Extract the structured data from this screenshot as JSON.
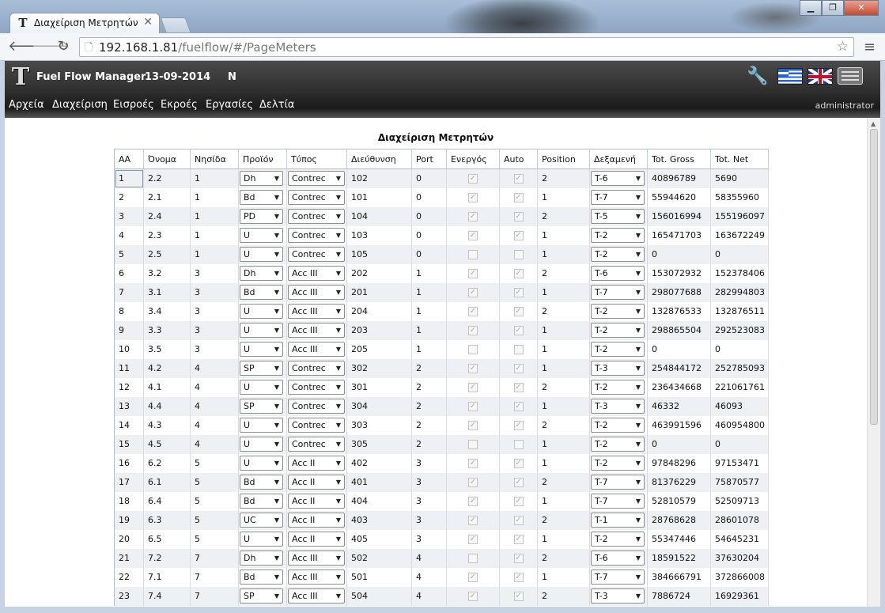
{
  "browser": {
    "tab_title": "Διαχείριση Μετρητών",
    "url_host": "192.168.1.81",
    "url_path": "/fuelflow/#/PageMeters"
  },
  "app": {
    "title": "Fuel Flow Manager",
    "date": "13-09-2014",
    "mode": "N",
    "user": "administrator",
    "menu": [
      "Αρχεία",
      "Διαχείριση",
      "Εισροές",
      "Εκροές",
      "Εργασίες",
      "Δελτία"
    ]
  },
  "page": {
    "caption": "Διαχείριση Μετρητών",
    "columns": [
      "ΑΑ",
      "Όνομα",
      "Νησίδα",
      "Προϊόν",
      "Τύπος",
      "Διεύθυνση",
      "Port",
      "Ενεργός",
      "Auto",
      "Position",
      "Δεξαμενή",
      "Tot. Gross",
      "Tot. Net"
    ],
    "rows": [
      {
        "aa": "1",
        "name": "2.2",
        "island": "1",
        "product": "Dh",
        "type": "Contrec",
        "address": "102",
        "port": "0",
        "active": true,
        "auto": true,
        "position": "2",
        "tank": "T-6",
        "gross": "40896789",
        "net": "5690"
      },
      {
        "aa": "2",
        "name": "2.1",
        "island": "1",
        "product": "Bd",
        "type": "Contrec",
        "address": "101",
        "port": "0",
        "active": true,
        "auto": true,
        "position": "1",
        "tank": "T-7",
        "gross": "55944620",
        "net": "58355960"
      },
      {
        "aa": "3",
        "name": "2.4",
        "island": "1",
        "product": "PD",
        "type": "Contrec",
        "address": "104",
        "port": "0",
        "active": true,
        "auto": true,
        "position": "2",
        "tank": "T-5",
        "gross": "156016994",
        "net": "155196097"
      },
      {
        "aa": "4",
        "name": "2.3",
        "island": "1",
        "product": "U",
        "type": "Contrec",
        "address": "103",
        "port": "0",
        "active": true,
        "auto": true,
        "position": "1",
        "tank": "T-2",
        "gross": "165471703",
        "net": "163672249"
      },
      {
        "aa": "5",
        "name": "2.5",
        "island": "1",
        "product": "U",
        "type": "Contrec",
        "address": "105",
        "port": "0",
        "active": false,
        "auto": false,
        "position": "1",
        "tank": "T-2",
        "gross": "0",
        "net": "0"
      },
      {
        "aa": "6",
        "name": "3.2",
        "island": "3",
        "product": "Dh",
        "type": "Acc III",
        "address": "202",
        "port": "1",
        "active": true,
        "auto": true,
        "position": "2",
        "tank": "T-6",
        "gross": "153072932",
        "net": "152378406"
      },
      {
        "aa": "7",
        "name": "3.1",
        "island": "3",
        "product": "Bd",
        "type": "Acc III",
        "address": "201",
        "port": "1",
        "active": true,
        "auto": true,
        "position": "1",
        "tank": "T-7",
        "gross": "298077688",
        "net": "282994803"
      },
      {
        "aa": "8",
        "name": "3.4",
        "island": "3",
        "product": "U",
        "type": "Acc III",
        "address": "204",
        "port": "1",
        "active": true,
        "auto": true,
        "position": "2",
        "tank": "T-2",
        "gross": "132876533",
        "net": "132876511"
      },
      {
        "aa": "9",
        "name": "3.3",
        "island": "3",
        "product": "U",
        "type": "Acc III",
        "address": "203",
        "port": "1",
        "active": true,
        "auto": true,
        "position": "1",
        "tank": "T-2",
        "gross": "298865504",
        "net": "292523083"
      },
      {
        "aa": "10",
        "name": "3.5",
        "island": "3",
        "product": "U",
        "type": "Acc III",
        "address": "205",
        "port": "1",
        "active": false,
        "auto": false,
        "position": "1",
        "tank": "T-2",
        "gross": "0",
        "net": "0"
      },
      {
        "aa": "11",
        "name": "4.2",
        "island": "4",
        "product": "SP",
        "type": "Contrec",
        "address": "302",
        "port": "2",
        "active": true,
        "auto": true,
        "position": "1",
        "tank": "T-3",
        "gross": "254844172",
        "net": "252785093"
      },
      {
        "aa": "12",
        "name": "4.1",
        "island": "4",
        "product": "U",
        "type": "Contrec",
        "address": "301",
        "port": "2",
        "active": true,
        "auto": true,
        "position": "2",
        "tank": "T-2",
        "gross": "236434668",
        "net": "221061761"
      },
      {
        "aa": "13",
        "name": "4.4",
        "island": "4",
        "product": "SP",
        "type": "Contrec",
        "address": "304",
        "port": "2",
        "active": true,
        "auto": true,
        "position": "1",
        "tank": "T-3",
        "gross": "46332",
        "net": "46093"
      },
      {
        "aa": "14",
        "name": "4.3",
        "island": "4",
        "product": "U",
        "type": "Contrec",
        "address": "303",
        "port": "2",
        "active": true,
        "auto": true,
        "position": "2",
        "tank": "T-2",
        "gross": "463991596",
        "net": "460954800"
      },
      {
        "aa": "15",
        "name": "4.5",
        "island": "4",
        "product": "U",
        "type": "Contrec",
        "address": "305",
        "port": "2",
        "active": false,
        "auto": false,
        "position": "1",
        "tank": "T-2",
        "gross": "0",
        "net": "0"
      },
      {
        "aa": "16",
        "name": "6.2",
        "island": "5",
        "product": "U",
        "type": "Acc II",
        "address": "402",
        "port": "3",
        "active": true,
        "auto": true,
        "position": "1",
        "tank": "T-2",
        "gross": "97848296",
        "net": "97153471"
      },
      {
        "aa": "17",
        "name": "6.1",
        "island": "5",
        "product": "Bd",
        "type": "Acc II",
        "address": "401",
        "port": "3",
        "active": true,
        "auto": true,
        "position": "2",
        "tank": "T-7",
        "gross": "81376229",
        "net": "75870577"
      },
      {
        "aa": "18",
        "name": "6.4",
        "island": "5",
        "product": "Bd",
        "type": "Acc II",
        "address": "404",
        "port": "3",
        "active": true,
        "auto": true,
        "position": "1",
        "tank": "T-7",
        "gross": "52810579",
        "net": "52509713"
      },
      {
        "aa": "19",
        "name": "6.3",
        "island": "5",
        "product": "UC",
        "type": "Acc II",
        "address": "403",
        "port": "3",
        "active": true,
        "auto": true,
        "position": "2",
        "tank": "T-1",
        "gross": "28768628",
        "net": "28601078"
      },
      {
        "aa": "20",
        "name": "6.5",
        "island": "5",
        "product": "U",
        "type": "Acc II",
        "address": "405",
        "port": "3",
        "active": true,
        "auto": true,
        "position": "1",
        "tank": "T-2",
        "gross": "55347446",
        "net": "54645231"
      },
      {
        "aa": "21",
        "name": "7.2",
        "island": "7",
        "product": "Dh",
        "type": "Acc III",
        "address": "502",
        "port": "4",
        "active": false,
        "auto": true,
        "position": "2",
        "tank": "T-6",
        "gross": "18591522",
        "net": "37630204"
      },
      {
        "aa": "22",
        "name": "7.1",
        "island": "7",
        "product": "Bd",
        "type": "Acc III",
        "address": "501",
        "port": "4",
        "active": true,
        "auto": true,
        "position": "1",
        "tank": "T-7",
        "gross": "384666791",
        "net": "372866008"
      },
      {
        "aa": "23",
        "name": "7.4",
        "island": "7",
        "product": "SP",
        "type": "Acc III",
        "address": "504",
        "port": "4",
        "active": true,
        "auto": true,
        "position": "2",
        "tank": "T-3",
        "gross": "7886724",
        "net": "16929361"
      }
    ]
  }
}
